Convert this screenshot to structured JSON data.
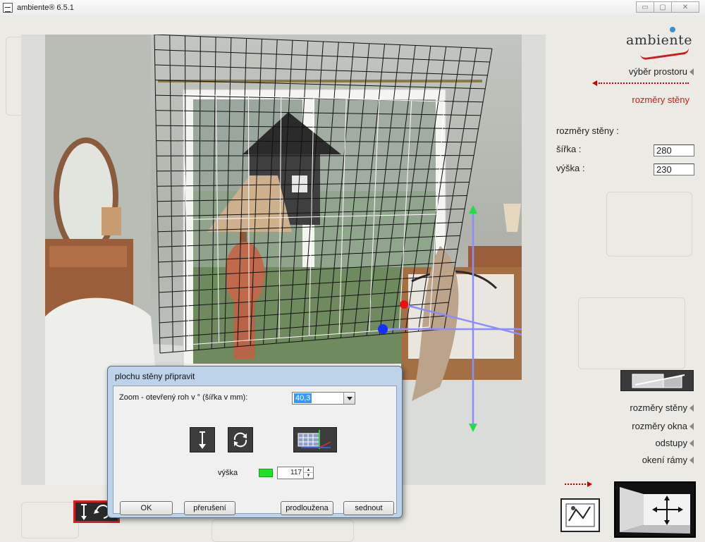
{
  "window": {
    "title": "ambiente® 6.5.1"
  },
  "brand": {
    "logo_text": "ambiente"
  },
  "right_panel": {
    "nav_link": "výběr prostoru",
    "active_step": "rozměry stěny",
    "section_title": "rozměry stěny :",
    "width_label": "šířka :",
    "width_value": "280",
    "height_label": "výška :",
    "height_value": "230",
    "menu": [
      "rozměry stěny",
      "rozměry okna",
      "odstupy",
      "okení rámy"
    ]
  },
  "dialog": {
    "title": "plochu stěny připravit",
    "zoom_label": "Zoom - otevřený roh v ° (šířka  v mm):",
    "zoom_value": "40,3",
    "height_label": "výška",
    "height_value": "117",
    "buttons": {
      "ok": "OK",
      "cancel": "přerušení",
      "extend": "prodloužena",
      "sit": "sednout"
    }
  },
  "colors": {
    "accent_red": "#d01a1a",
    "height_indicator": "#21e221",
    "dialog_frame": "#bcd3ea"
  }
}
